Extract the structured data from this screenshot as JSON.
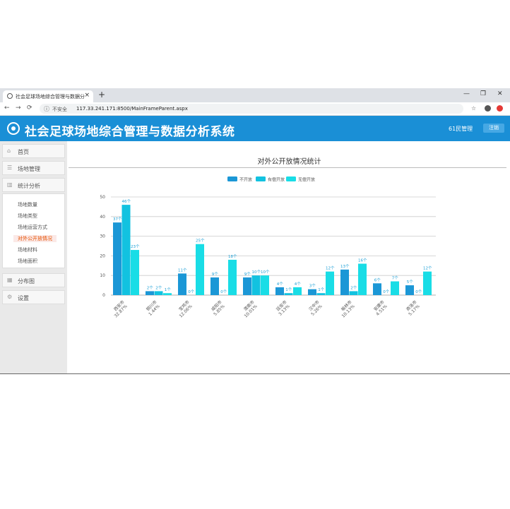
{
  "browser": {
    "tab_title": "社会足球场地综合管理与数据分析系",
    "tab_close": "×",
    "new_tab": "+",
    "security": "不安全",
    "url": "117.33.241.171:8500/MainFrameParent.aspx"
  },
  "app": {
    "title": "社会足球场地综合管理与数据分析系统",
    "user": "61民管理",
    "exit": "注销"
  },
  "sidebar": {
    "home": "首页",
    "venue_mgmt": "场地管理",
    "stats": "统计分析",
    "sub_items": [
      "场地数量",
      "场地类型",
      "场地运营方式",
      "对外公开放情况",
      "场地材料",
      "场地面积"
    ],
    "active_index": 3,
    "distribution": "分布图",
    "settings": "设置"
  },
  "chart_data": {
    "type": "bar",
    "title": "对外公开放情况统计",
    "legend": [
      "不开放",
      "有偿开放",
      "无偿开放"
    ],
    "colors": [
      "#1b97d6",
      "#12c2e0",
      "#19dde6"
    ],
    "ylim": [
      0,
      50
    ],
    "yticks": [
      0,
      10,
      20,
      30,
      40,
      50
    ],
    "grid": true,
    "categories": [
      [
        "西安市",
        "32.87%"
      ],
      [
        "铜川市",
        "1.44%"
      ],
      [
        "宝鸡市",
        "12.06%"
      ],
      [
        "咸阳市",
        "5.85%"
      ],
      [
        "渭南市",
        "10.01%"
      ],
      [
        "延安市",
        "3.13%"
      ],
      [
        "汉中市",
        "5.26%"
      ],
      [
        "榆林市",
        "10.13%"
      ],
      [
        "安康市",
        "4.51%"
      ],
      [
        "商洛市",
        "5.17%"
      ]
    ],
    "series": [
      {
        "name": "不开放",
        "values": [
          37,
          2,
          11,
          9,
          9,
          4,
          3,
          13,
          6,
          5
        ],
        "labels": [
          "37个",
          "2个",
          "11个",
          "9个",
          "9个",
          "4个",
          "3个",
          "13个",
          "6个",
          "5个"
        ]
      },
      {
        "name": "有偿开放",
        "values": [
          46,
          2,
          0,
          0,
          10,
          1,
          1,
          2,
          0,
          0
        ],
        "labels": [
          "46个",
          "2个",
          "0个",
          "0个",
          "10个",
          "1个",
          "1个",
          "2个",
          "0个",
          "0个"
        ]
      },
      {
        "name": "无偿开放",
        "values": [
          23,
          1,
          26,
          18,
          10,
          4,
          12,
          16,
          7,
          12
        ],
        "labels": [
          "23个",
          "1个",
          "25个",
          "18个",
          "10个",
          "4个",
          "12个",
          "16个",
          "7个",
          "12个"
        ]
      }
    ]
  }
}
